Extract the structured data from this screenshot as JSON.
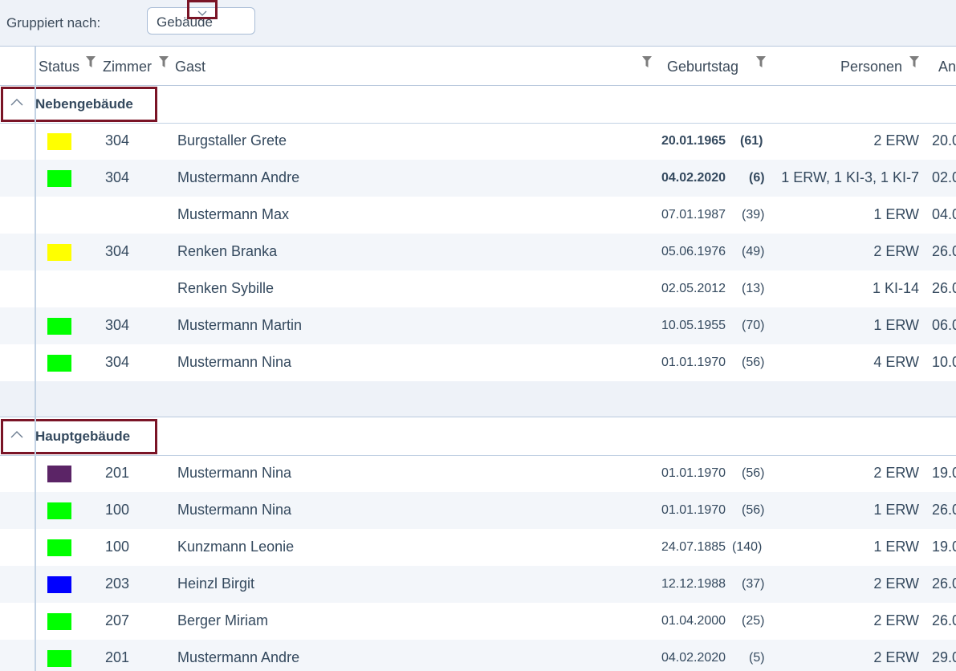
{
  "toolbar": {
    "group_label": "Gruppiert nach:",
    "group_value": "Gebäude"
  },
  "columns": {
    "status": "Status",
    "room": "Zimmer",
    "guest": "Gast",
    "birthday": "Geburtstag",
    "persons": "Personen",
    "arrival": "An"
  },
  "groups": [
    {
      "title": "Nebengebäude",
      "rows": [
        {
          "status_color": "#ffff00",
          "room": "304",
          "guest": "Burgstaller Grete",
          "birthday": "20.01.1965",
          "age": "(61)",
          "persons": "2 ERW",
          "arrival": "20.0",
          "bold": true
        },
        {
          "status_color": "#00ff00",
          "room": "304",
          "guest": "Mustermann Andre",
          "birthday": "04.02.2020",
          "age": "(6)",
          "persons": "1 ERW, 1 KI-3, 1 KI-7",
          "arrival": "02.0",
          "bold": true
        },
        {
          "status_color": "",
          "room": "",
          "guest": "Mustermann Max",
          "birthday": "07.01.1987",
          "age": "(39)",
          "persons": "1 ERW",
          "arrival": "04.0",
          "bold": false
        },
        {
          "status_color": "#ffff00",
          "room": "304",
          "guest": "Renken Branka",
          "birthday": "05.06.1976",
          "age": "(49)",
          "persons": "2 ERW",
          "arrival": "26.0",
          "bold": false
        },
        {
          "status_color": "",
          "room": "",
          "guest": "Renken Sybille",
          "birthday": "02.05.2012",
          "age": "(13)",
          "persons": "1 KI-14",
          "arrival": "26.0",
          "bold": false
        },
        {
          "status_color": "#00ff00",
          "room": "304",
          "guest": "Mustermann Martin",
          "birthday": "10.05.1955",
          "age": "(70)",
          "persons": "1 ERW",
          "arrival": "06.0",
          "bold": false
        },
        {
          "status_color": "#00ff00",
          "room": "304",
          "guest": "Mustermann Nina",
          "birthday": "01.01.1970",
          "age": "(56)",
          "persons": "4 ERW",
          "arrival": "10.0",
          "bold": false
        }
      ]
    },
    {
      "title": "Hauptgebäude",
      "rows": [
        {
          "status_color": "#5b2466",
          "room": "201",
          "guest": "Mustermann Nina",
          "birthday": "01.01.1970",
          "age": "(56)",
          "persons": "2 ERW",
          "arrival": "19.0",
          "bold": false
        },
        {
          "status_color": "#00ff00",
          "room": "100",
          "guest": "Mustermann Nina",
          "birthday": "01.01.1970",
          "age": "(56)",
          "persons": "1 ERW",
          "arrival": "26.0",
          "bold": false
        },
        {
          "status_color": "#00ff00",
          "room": "100",
          "guest": "Kunzmann Leonie",
          "birthday": "24.07.1885",
          "age": "(140)",
          "persons": "1 ERW",
          "arrival": "19.0",
          "bold": false
        },
        {
          "status_color": "#0000ff",
          "room": "203",
          "guest": "Heinzl Birgit",
          "birthday": "12.12.1988",
          "age": "(37)",
          "persons": "2 ERW",
          "arrival": "26.0",
          "bold": false
        },
        {
          "status_color": "#00ff00",
          "room": "207",
          "guest": "Berger Miriam",
          "birthday": "01.04.2000",
          "age": "(25)",
          "persons": "2 ERW",
          "arrival": "26.0",
          "bold": false
        },
        {
          "status_color": "#00ff00",
          "room": "201",
          "guest": "Mustermann Andre",
          "birthday": "04.02.2020",
          "age": "(5)",
          "persons": "2 ERW",
          "arrival": "29.0",
          "bold": false
        }
      ]
    }
  ],
  "icons": {
    "dropdown": "chevron-down-icon",
    "filter": "funnel-icon",
    "collapse": "chevron-up-icon"
  },
  "colors": {
    "highlight_border": "#7a1426",
    "header_bg": "#eef2f8",
    "row_alt_bg": "#f3f6fa",
    "text": "#34495e"
  }
}
